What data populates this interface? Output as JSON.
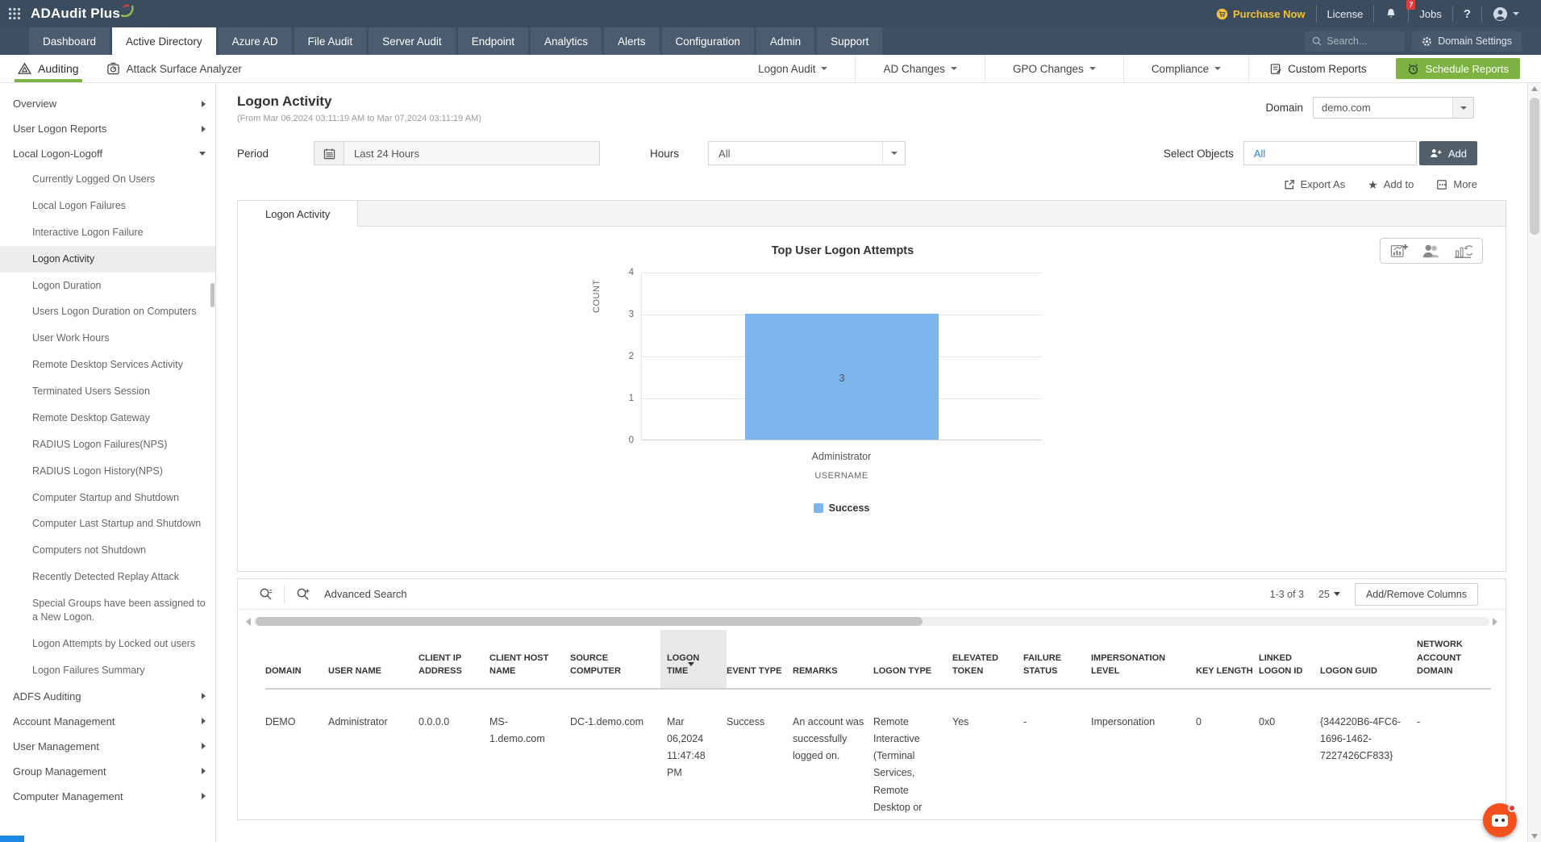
{
  "topbar": {
    "logo": "ADAudit Plus",
    "purchase_now": "Purchase Now",
    "license": "License",
    "notification_count": "7",
    "jobs": "Jobs",
    "help": "?"
  },
  "nav": {
    "tabs": [
      "Dashboard",
      "Active Directory",
      "Azure AD",
      "File Audit",
      "Server Audit",
      "Endpoint",
      "Analytics",
      "Alerts",
      "Configuration",
      "Admin",
      "Support"
    ],
    "active_tab": "Active Directory",
    "search_placeholder": "Search...",
    "domain_settings": "Domain Settings"
  },
  "subnav": {
    "auditing": "Auditing",
    "attack_surface_analyzer": "Attack Surface Analyzer",
    "logon_audit": "Logon Audit",
    "ad_changes": "AD Changes",
    "gpo_changes": "GPO Changes",
    "compliance": "Compliance",
    "custom_reports": "Custom Reports",
    "schedule_reports": "Schedule Reports"
  },
  "sidebar": {
    "items": [
      {
        "label": "Overview"
      },
      {
        "label": "User Logon Reports"
      },
      {
        "label": "Local Logon-Logoff"
      },
      {
        "label": "Currently Logged On Users"
      },
      {
        "label": "Local Logon Failures"
      },
      {
        "label": "Interactive Logon Failure"
      },
      {
        "label": "Logon Activity"
      },
      {
        "label": "Logon Duration"
      },
      {
        "label": "Users Logon Duration on Computers"
      },
      {
        "label": "User Work Hours"
      },
      {
        "label": "Remote Desktop Services Activity"
      },
      {
        "label": "Terminated Users Session"
      },
      {
        "label": "Remote Desktop Gateway"
      },
      {
        "label": "RADIUS Logon Failures(NPS)"
      },
      {
        "label": "RADIUS Logon History(NPS)"
      },
      {
        "label": "Computer Startup and Shutdown"
      },
      {
        "label": "Computer Last Startup and Shutdown"
      },
      {
        "label": "Computers not Shutdown"
      },
      {
        "label": "Recently Detected Replay Attack"
      },
      {
        "label": "Special Groups have been assigned to a New Logon."
      },
      {
        "label": "Logon Attempts by Locked out users"
      },
      {
        "label": "Logon Failures Summary"
      },
      {
        "label": "ADFS Auditing"
      },
      {
        "label": "Account Management"
      },
      {
        "label": "User Management"
      },
      {
        "label": "Group Management"
      },
      {
        "label": "Computer Management"
      }
    ]
  },
  "page": {
    "title": "Logon Activity",
    "date_range": "(From Mar 06,2024 03:11:19 AM to Mar 07,2024 03:11:19 AM)",
    "domain_label": "Domain",
    "domain_value": "demo.com",
    "report_tab": "Logon Activity"
  },
  "filters": {
    "period_label": "Period",
    "period_value": "Last 24 Hours",
    "hours_label": "Hours",
    "hours_value": "All",
    "select_objects_label": "Select Objects",
    "select_objects_value": "All",
    "add_button": "Add"
  },
  "actions": {
    "export_as": "Export As",
    "add_to": "Add to",
    "more": "More"
  },
  "chart_data": {
    "type": "bar",
    "title": "Top User Logon Attempts",
    "categories": [
      "Administrator"
    ],
    "series": [
      {
        "name": "Success",
        "values": [
          3
        ],
        "color": "#7cb5ec"
      }
    ],
    "xlabel": "USERNAME",
    "ylabel": "COUNT",
    "ylim": [
      0,
      4
    ],
    "yticks": [
      0,
      1,
      2,
      3,
      4
    ],
    "grid": true,
    "legend_position": "bottom"
  },
  "table": {
    "advanced_search": "Advanced Search",
    "pagination": "1-3 of 3",
    "page_size": "25",
    "add_remove_columns": "Add/Remove Columns",
    "sorted_column": "LOGON TIME",
    "columns": [
      "DOMAIN",
      "USER NAME",
      "CLIENT IP ADDRESS",
      "CLIENT HOST NAME",
      "SOURCE COMPUTER",
      "LOGON TIME",
      "EVENT TYPE",
      "REMARKS",
      "LOGON TYPE",
      "ELEVATED TOKEN",
      "FAILURE STATUS",
      "IMPERSONATION LEVEL",
      "KEY LENGTH",
      "LINKED LOGON ID",
      "LOGON GUID",
      "NETWORK ACCOUNT DOMAIN"
    ],
    "rows": [
      {
        "cells": [
          "DEMO",
          "Administrator",
          "0.0.0.0",
          "MS-1.demo.com",
          "DC-1.demo.com",
          "Mar 06,2024 11:47:48 PM",
          "Success",
          "An account was successfully logged on.",
          "Remote Interactive (Terminal Services, Remote Desktop or",
          "Yes",
          "-",
          "Impersonation",
          "0",
          "0x0",
          "{344220B6-4FC6-1696-1462-7227426CF833}",
          "-"
        ]
      }
    ]
  }
}
